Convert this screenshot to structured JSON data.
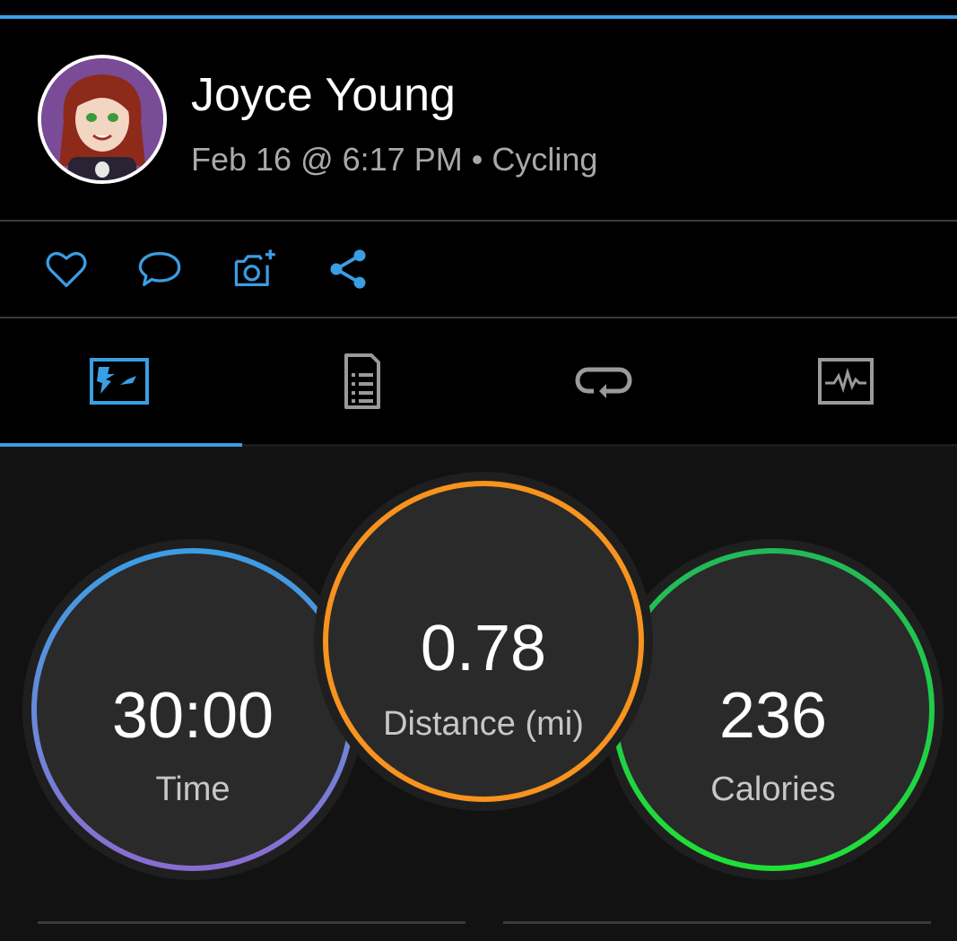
{
  "profile": {
    "name": "Joyce Young",
    "date": "Feb 16 @ 6:17 PM",
    "separator": "•",
    "activity_type": "Cycling"
  },
  "actions": [
    {
      "icon": "heart-icon"
    },
    {
      "icon": "comment-icon"
    },
    {
      "icon": "add-photo-icon"
    },
    {
      "icon": "share-icon"
    }
  ],
  "tabs": [
    {
      "icon": "map-icon",
      "selected": true
    },
    {
      "icon": "details-icon",
      "selected": false
    },
    {
      "icon": "laps-icon",
      "selected": false
    },
    {
      "icon": "charts-icon",
      "selected": false
    }
  ],
  "stats": {
    "time": {
      "value": "30:00",
      "label": "Time"
    },
    "distance": {
      "value": "0.78",
      "label": "Distance (mi)"
    },
    "calories": {
      "value": "236",
      "label": "Calories"
    }
  },
  "colors": {
    "accent": "#3a9ee4",
    "distance_ring": "#f7931e",
    "calories_ring": "#1fe037",
    "time_ring_top": "#3a9ee4",
    "time_ring_bottom": "#8a6bd1"
  }
}
